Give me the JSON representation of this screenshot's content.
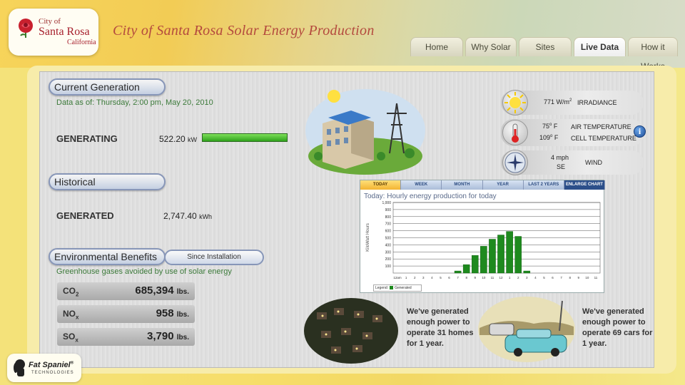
{
  "header": {
    "logo_city_of": "City of",
    "logo_city": "Santa Rosa",
    "logo_state": "California",
    "title": "City of Santa Rosa Solar Energy Production"
  },
  "nav": {
    "tabs": [
      {
        "label": "Home"
      },
      {
        "label": "Why Solar"
      },
      {
        "label": "Sites"
      },
      {
        "label": "Live Data"
      },
      {
        "label": "How it Works"
      }
    ],
    "active": "Live Data"
  },
  "current": {
    "heading": "Current Generation",
    "data_as_of": "Data as of: Thursday, 2:00 pm,   May 20, 2010",
    "status": "GENERATING",
    "value": "522.20",
    "unit": "kW",
    "level_fraction": 1.0
  },
  "historical": {
    "heading": "Historical",
    "label": "GENERATED",
    "value": "2,747.40",
    "unit": "kWh"
  },
  "environment": {
    "heading": "Environmental Benefits",
    "scope": "Since Installation",
    "subtitle": "Greenhouse gases avoided by use of solar energy",
    "gases": [
      {
        "name": "CO",
        "sub": "2",
        "amount": "685,394",
        "unit": "lbs."
      },
      {
        "name": "NO",
        "sub": "x",
        "amount": "958",
        "unit": "lbs."
      },
      {
        "name": "SO",
        "sub": "x",
        "amount": "3,790",
        "unit": "lbs."
      }
    ]
  },
  "weather": {
    "irradiance_value": "771 W/m",
    "irradiance_sup": "2",
    "irradiance_label": "IRRADIANCE",
    "air_temp": "75",
    "cell_temp": "109",
    "temp_unit": "F",
    "air_label": "AIR TEMPERATURE",
    "cell_label": "CELL TEMPERATURE",
    "wind_speed": "4 mph",
    "wind_dir": "SE",
    "wind_label": "WIND",
    "info_symbol": "i"
  },
  "chart_tabs": [
    "TODAY",
    "WEEK",
    "MONTH",
    "YEAR",
    "LAST 2 YEARS",
    "ENLARGE CHART"
  ],
  "chart_data": {
    "type": "bar",
    "title": "Today: Hourly energy production for today",
    "ylabel": "KiloWatt Hours",
    "ylim": [
      0,
      1000
    ],
    "yticks": [
      "100",
      "200",
      "300",
      "400",
      "500",
      "600",
      "700",
      "800",
      "900",
      "1,000"
    ],
    "categories": [
      "12am",
      "1",
      "2",
      "3",
      "4",
      "5",
      "6",
      "7",
      "8",
      "9",
      "10",
      "11",
      "12",
      "1",
      "2",
      "3",
      "4",
      "5",
      "6",
      "7",
      "8",
      "9",
      "10",
      "11"
    ],
    "series": [
      {
        "name": "Generated",
        "values": [
          0,
          0,
          0,
          0,
          0,
          0,
          0,
          30,
          120,
          250,
          380,
          480,
          540,
          590,
          520,
          30,
          0,
          0,
          0,
          0,
          0,
          0,
          0,
          0
        ]
      }
    ],
    "legend_title": "Legend:",
    "color": "#1e8a1e"
  },
  "illustrations": {
    "homes_text": "We've generated enough power to operate 31 homes for 1 year.",
    "homes_lines": [
      "We've generated",
      "enough power to",
      "operate 31 homes",
      "for 1 year."
    ],
    "cars_lines": [
      "We've generated",
      "enough power to",
      "operate 69 cars for",
      "1 year."
    ]
  },
  "footer": {
    "brand": "Fat Spaniel",
    "brand_mark": "®",
    "tagline": "TECHNOLOGIES"
  }
}
